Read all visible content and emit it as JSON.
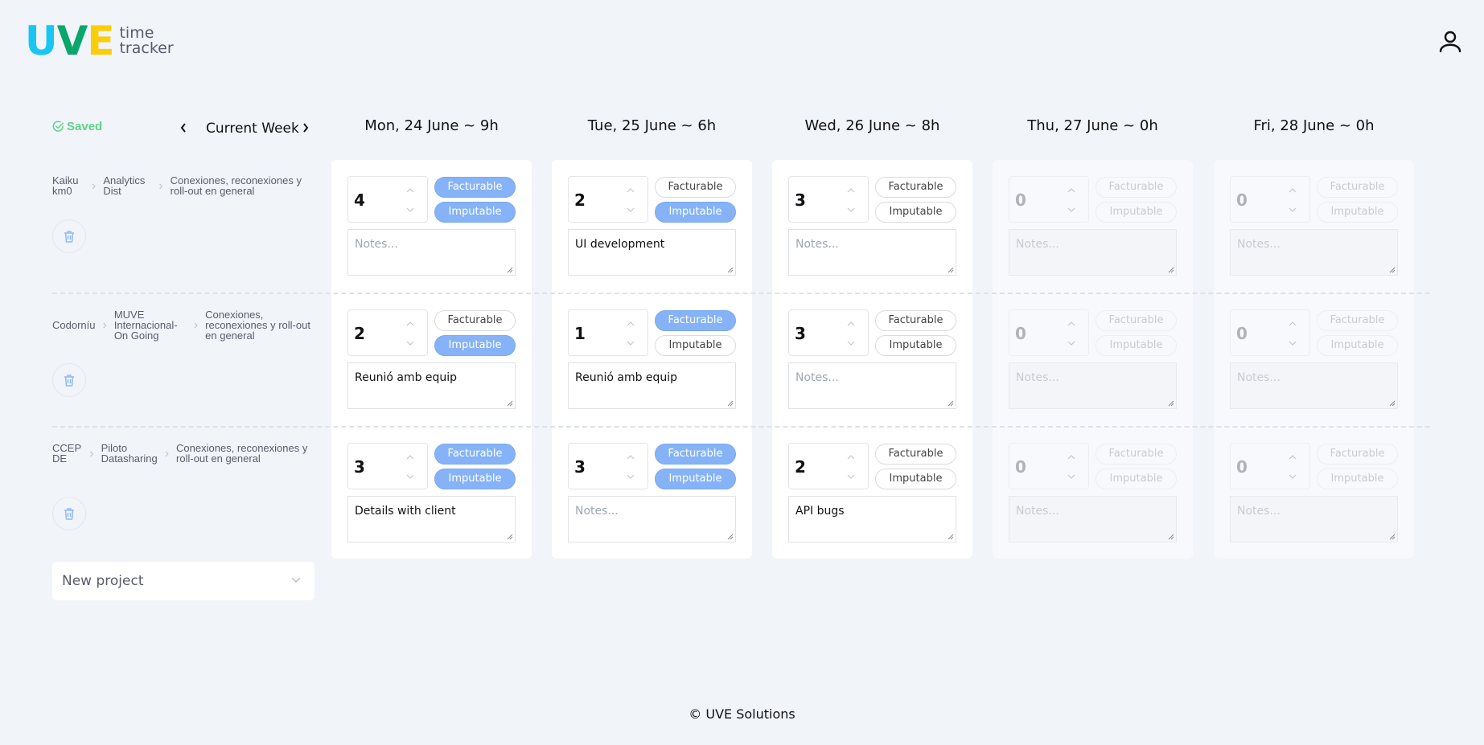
{
  "app": {
    "logo_letters": [
      "U",
      "V",
      "E"
    ],
    "logo_text_line1": "time",
    "logo_text_line2": "tracker",
    "user_icon": "user-icon"
  },
  "colors": {
    "logo_u": "#18c6f2",
    "logo_v": "#0aa66b",
    "logo_e": "#fccd0b",
    "saved_green": "#5fd38a",
    "pill_active": "#86b3f7",
    "background": "#f1f4f9"
  },
  "status": {
    "label": "Saved",
    "icon": "check-circle-icon"
  },
  "week_nav": {
    "label": "Current Week",
    "prev_icon": "chevron-left-icon",
    "next_icon": "chevron-right-icon"
  },
  "days": [
    {
      "label": "Mon, 24 June ~ 9h",
      "enabled": true
    },
    {
      "label": "Tue, 25 June ~ 6h",
      "enabled": true
    },
    {
      "label": "Wed, 26 June ~ 8h",
      "enabled": true
    },
    {
      "label": "Thu, 27 June ~ 0h",
      "enabled": false
    },
    {
      "label": "Fri, 28 June ~ 0h",
      "enabled": false
    }
  ],
  "pill_labels": {
    "facturable": "Facturable",
    "imputable": "Imputable"
  },
  "notes_placeholder": "Notes...",
  "rows": [
    {
      "breadcrumb": [
        "Kaiku km0",
        "Analytics Dist",
        "Conexiones, reconexiones y roll-out en general"
      ],
      "entries": [
        {
          "hours": "4",
          "facturable": true,
          "imputable": true,
          "notes": ""
        },
        {
          "hours": "2",
          "facturable": false,
          "imputable": true,
          "notes": "UI development"
        },
        {
          "hours": "3",
          "facturable": false,
          "imputable": false,
          "notes": ""
        },
        {
          "hours": "0",
          "facturable": false,
          "imputable": false,
          "notes": ""
        },
        {
          "hours": "0",
          "facturable": false,
          "imputable": false,
          "notes": ""
        }
      ]
    },
    {
      "breadcrumb": [
        "Codorníu",
        "MUVE Internacional-On Going",
        "Conexiones, reconexiones y roll-out en general"
      ],
      "entries": [
        {
          "hours": "2",
          "facturable": false,
          "imputable": true,
          "notes": "Reunió amb equip"
        },
        {
          "hours": "1",
          "facturable": true,
          "imputable": false,
          "notes": "Reunió amb equip"
        },
        {
          "hours": "3",
          "facturable": false,
          "imputable": false,
          "notes": ""
        },
        {
          "hours": "0",
          "facturable": false,
          "imputable": false,
          "notes": ""
        },
        {
          "hours": "0",
          "facturable": false,
          "imputable": false,
          "notes": ""
        }
      ]
    },
    {
      "breadcrumb": [
        "CCEP DE",
        "Piloto Datasharing",
        "Conexiones, reconexiones y roll-out en general"
      ],
      "entries": [
        {
          "hours": "3",
          "facturable": true,
          "imputable": true,
          "notes": "Details with client"
        },
        {
          "hours": "3",
          "facturable": true,
          "imputable": true,
          "notes": ""
        },
        {
          "hours": "2",
          "facturable": false,
          "imputable": false,
          "notes": "API bugs"
        },
        {
          "hours": "0",
          "facturable": false,
          "imputable": false,
          "notes": ""
        },
        {
          "hours": "0",
          "facturable": false,
          "imputable": false,
          "notes": ""
        }
      ]
    }
  ],
  "new_project": {
    "label": "New project",
    "icon": "chevron-down-icon"
  },
  "footer": {
    "text": "© UVE Solutions"
  }
}
